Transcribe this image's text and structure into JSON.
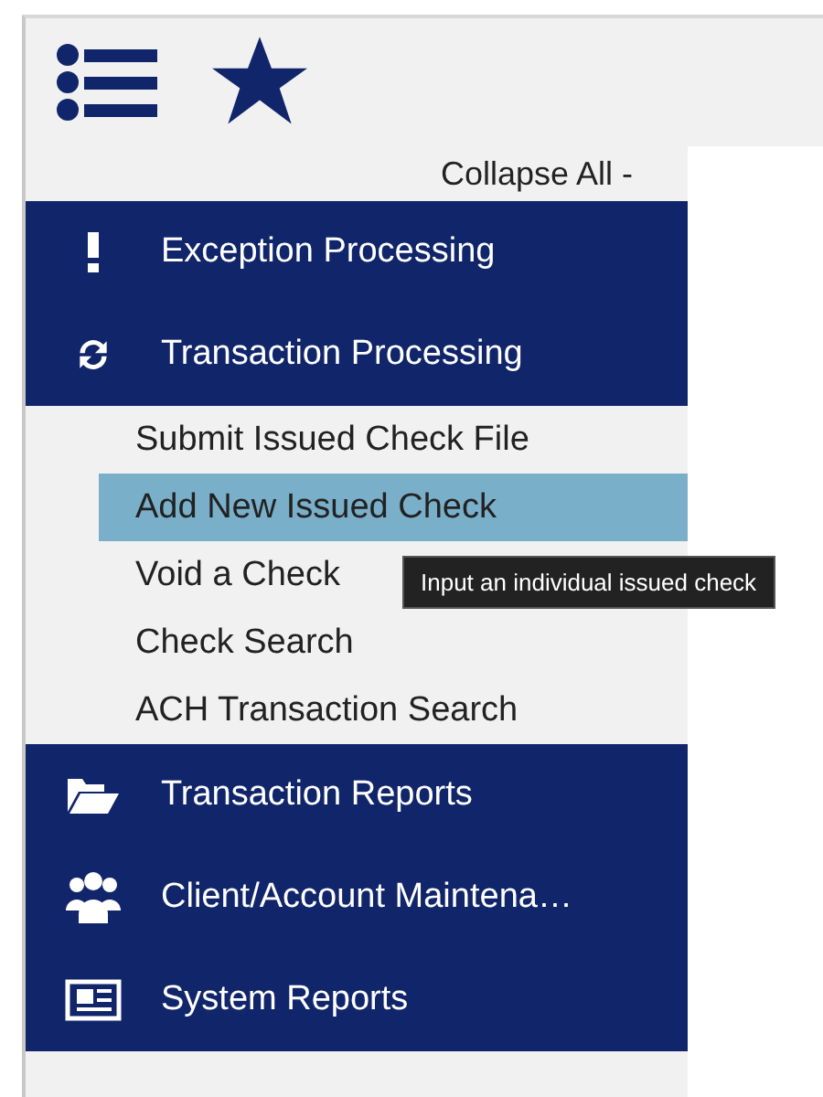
{
  "collapse_all": "Collapse All -",
  "sections": [
    {
      "label": "Exception Processing"
    },
    {
      "label": "Transaction Processing",
      "items": [
        {
          "label": "Submit Issued Check File",
          "selected": false
        },
        {
          "label": "Add New Issued Check",
          "selected": true
        },
        {
          "label": "Void a Check",
          "selected": false
        },
        {
          "label": "Check Search",
          "selected": false
        },
        {
          "label": "ACH Transaction Search",
          "selected": false
        }
      ]
    },
    {
      "label": "Transaction Reports"
    },
    {
      "label": "Client/Account Maintena…"
    },
    {
      "label": "System Reports"
    }
  ],
  "tooltip": {
    "text": "Input an individual issued check"
  }
}
